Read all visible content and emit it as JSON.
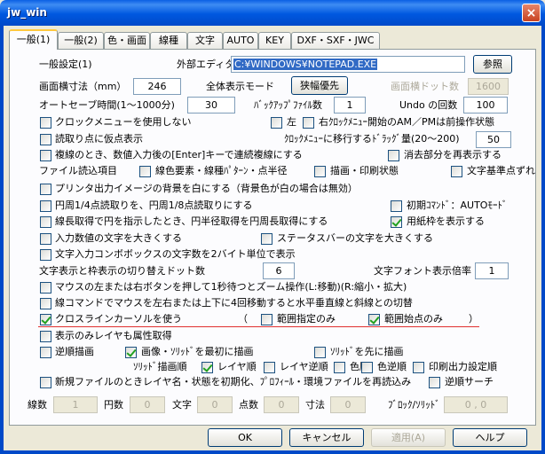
{
  "window": {
    "title": "jw_win",
    "close_glyph": "×"
  },
  "tabs": [
    "一般(1)",
    "一般(2)",
    "色・画面",
    "線種",
    "文字",
    "AUTO",
    "KEY",
    "DXF・SXF・JWC"
  ],
  "general": {
    "section_title": "一般設定(1)",
    "editor_label": "外部エディタ",
    "editor_value": "C:¥WINDOWS¥NOTEPAD.EXE",
    "browse_button": "参照",
    "screen_width_label": "画面横寸法（mm）",
    "screen_width_value": "246",
    "full_display_label": "全体表示モード",
    "full_display_button": "狭幅優先",
    "screen_dots_label": "画面横ドット数",
    "screen_dots_value": "1600",
    "autosave_label": "オートセーブ時間(1～1000分)",
    "autosave_value": "30",
    "backup_label": "ﾊﾞｯｸｱｯﾌﾟﾌｧｲﾙ数",
    "backup_value": "1",
    "undo_label": "Undo の回数",
    "undo_value": "100"
  },
  "checks": {
    "clock_menu": "クロックメニューを使用しない",
    "left": "左",
    "right_clock": "右ｸﾛｯｸﾒﾆｭｰ開始のAM／PMは前操作状態",
    "read_point": "読取り点に仮点表示",
    "clock_drag_label": "ｸﾛｯｸﾒﾆｭｰに移行するﾄﾞﾗｯｸﾞ量(20～200)",
    "clock_drag_value": "50",
    "double_line": "複線のとき、数値入力後の[Enter]キーで連続複線にする",
    "erase_redisplay": "消去部分を再表示する",
    "file_read_label": "ファイル読込項目",
    "color_line": "線色要素・線種ﾊﾟﾀｰﾝ・点半径",
    "draw_print": "描画・印刷状態",
    "text_base": "文字基準点ずれ",
    "printer_bg": "プリンタ出力イメージの背景を白にする（背景色が白の場合は無効）",
    "circle_quarter": "円周1/4点読取りを、円周1/8点読取りにする",
    "initial_cmd": "初期ｺﾏﾝﾄﾞ：AUTOﾓｰﾄﾞ",
    "line_length": "線長取得で円を指示したとき、円半径取得を円周長取得にする",
    "paper_frame": "用紙枠を表示する",
    "input_text_big": "入力数値の文字を大きくする",
    "statusbar_big": "ステータスバーの文字を大きくする",
    "combo_2byte": "文字入力コンボボックスの文字数を2バイト単位で表示",
    "dot_switch_label": "文字表示と枠表示の切り替えドット数",
    "dot_switch_value": "6",
    "font_ratio_label": "文字フォント表示倍率",
    "font_ratio_value": "1",
    "mouse_zoom": "マウスの左または右ボタンを押して1秒待つとズーム操作(L:移動)(R:縮小・拡大)",
    "line_cmd": "線コマンドでマウスを左右または上下に4回移動すると水平垂直線と斜線との切替",
    "crossline": "クロスラインカーソルを使う",
    "paren_open": "（",
    "range_only": "範囲指定のみ",
    "range_start_only": "範囲始点のみ",
    "paren_close": "）",
    "display_only_layer": "表示のみレイヤも属性取得",
    "reverse_draw": "逆順描画",
    "image_solid_first": "画像・ｿﾘｯﾄﾞを最初に描画",
    "solid_first": "ｿﾘｯﾄﾞを先に描画",
    "solid_order_label": "ｿﾘｯﾄﾞ描画順",
    "layer_order": "レイヤ順",
    "layer_reverse": "レイヤ逆順",
    "color_order": "色順",
    "color_reverse": "色逆順",
    "print_order": "印刷出力設定順",
    "new_file_init": "新規ファイルのときレイヤ名・状態を初期化、ﾌﾟﾛﾌｨｰﾙ・環境ファイルを再読込み",
    "reverse_search": "逆順サーチ"
  },
  "counts": {
    "lines_label": "線数",
    "lines_value": "1",
    "arcs_label": "円数",
    "arcs_value": "0",
    "text_label": "文字",
    "text_value": "0",
    "points_label": "点数",
    "points_value": "0",
    "dims_label": "寸法",
    "dims_value": "0",
    "block_label": "ﾌﾞﾛｯｸ/ｿﾘｯﾄﾞ",
    "block_value": "0 , 0"
  },
  "footer": {
    "ok": "OK",
    "cancel": "キャンセル",
    "apply": "適用(A)",
    "help": "ヘルプ"
  },
  "state": {
    "clock_menu": false,
    "left": false,
    "right_clock": false,
    "read_point": false,
    "double_line": false,
    "erase_redisplay": false,
    "color_line": false,
    "draw_print": false,
    "text_base": false,
    "printer_bg": false,
    "circle_quarter": false,
    "initial_cmd": false,
    "line_length": false,
    "paper_frame": true,
    "input_text_big": false,
    "statusbar_big": false,
    "combo_2byte": false,
    "mouse_zoom": false,
    "line_cmd": false,
    "crossline": true,
    "range_only": false,
    "range_start_only": true,
    "display_only_layer": false,
    "reverse_draw": false,
    "image_solid_first": true,
    "solid_first": false,
    "layer_order": true,
    "layer_reverse": false,
    "color_order": false,
    "color_reverse": false,
    "print_order": false,
    "new_file_init": false,
    "reverse_search": false
  },
  "colors": {
    "accent_line": "#E03030",
    "title_bar": "#0058E0",
    "face": "#ECE9D8"
  }
}
